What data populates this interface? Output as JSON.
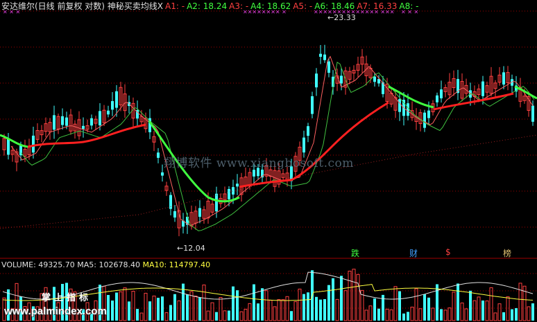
{
  "header": {
    "title": "安达维尔(日线 前复权 对数) 神秘买卖均线X",
    "items": [
      {
        "label": "A1: -",
        "color": "#ff4040"
      },
      {
        "label": "A2: 18.24",
        "color": "#40ff40"
      },
      {
        "label": "A3: -",
        "color": "#ff4040"
      },
      {
        "label": "A4: 18.62",
        "color": "#40ff40"
      },
      {
        "label": "A5: -",
        "color": "#ff4040"
      },
      {
        "label": "A6: 18.46",
        "color": "#40ff40"
      },
      {
        "label": "A7: 16.33",
        "color": "#ff4040"
      },
      {
        "label": "A8: -",
        "color": "#40ff40"
      }
    ]
  },
  "annotations": {
    "high": "←23.33",
    "low": "←12.04"
  },
  "signals": [
    {
      "text": "跌",
      "color": "#40ff40"
    },
    {
      "text": "财",
      "color": "#40a0ff"
    },
    {
      "text": "$",
      "color": "#ff4040"
    },
    {
      "text": "榜",
      "color": "#e0c070"
    }
  ],
  "watermark": "翔博软件 www.xiangbosoft.com",
  "volume_header": {
    "volume": "VOLUME: 49325.70",
    "ma5": "MA5: 102678.40",
    "ma10": "MA10: 114797.40",
    "colors": {
      "volume": "#e0e0e0",
      "ma5": "#e0e0e0",
      "ma10": "#ffff40"
    }
  },
  "logo": {
    "text": "掌上指标",
    "url": "www.palmindex.com"
  },
  "colors": {
    "up": "#ff4040",
    "down": "#40ffff",
    "grid": "#a00000",
    "buy_line": "#ff2020",
    "sell_line": "#40ff40"
  }
}
